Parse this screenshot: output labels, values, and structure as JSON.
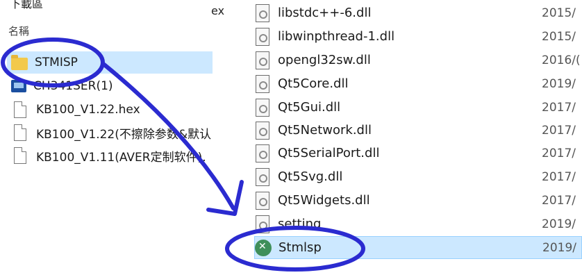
{
  "left_pane": {
    "top_partial": "下載區",
    "top_partial_right": "ex",
    "column_header_name": "名稱",
    "items": [
      {
        "label": "STMISP",
        "icon": "folder-icon"
      },
      {
        "label": "CH341SER(1)",
        "icon": "installer-icon"
      },
      {
        "label": "KB100_V1.22.hex",
        "icon": "file-icon"
      },
      {
        "label": "KB100_V1.22(不擦除参数&默认",
        "icon": "file-icon"
      },
      {
        "label": "KB100_V1.11(AVER定制软件).",
        "icon": "file-icon"
      }
    ]
  },
  "right_pane": {
    "items": [
      {
        "name": "libstdc++-6.dll",
        "date": "2015/"
      },
      {
        "name": "libwinpthread-1.dll",
        "date": "2015/"
      },
      {
        "name": "opengl32sw.dll",
        "date": "2016/("
      },
      {
        "name": "Qt5Core.dll",
        "date": "2019/"
      },
      {
        "name": "Qt5Gui.dll",
        "date": "2017/"
      },
      {
        "name": "Qt5Network.dll",
        "date": "2017/"
      },
      {
        "name": "Qt5SerialPort.dll",
        "date": "2017/"
      },
      {
        "name": "Qt5Svg.dll",
        "date": "2017/"
      },
      {
        "name": "Qt5Widgets.dll",
        "date": "2017/"
      },
      {
        "name": "setting",
        "date": "2019/"
      },
      {
        "name": "Stmlsp",
        "date": "2019/"
      }
    ]
  },
  "colors": {
    "selection": "#cce8ff",
    "annotation": "#2b2bd0"
  }
}
